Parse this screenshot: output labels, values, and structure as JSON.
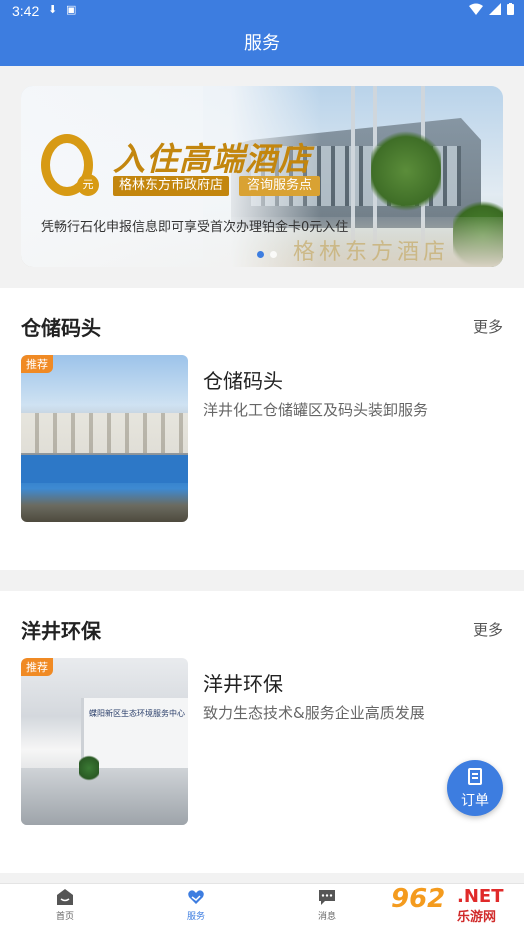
{
  "status_bar": {
    "time": "3:42"
  },
  "header": {
    "title": "服务"
  },
  "banner": {
    "headline": "入住高端酒店",
    "zero_symbol": "0",
    "yuan_label": "元",
    "hotel_name": "格林东方市政府店",
    "consult_label": "咨询服务点",
    "caption": "凭畅行石化申报信息即可享受首次办理铂金卡0元入住",
    "sign_text": "格林东方酒店",
    "slide_count": 2,
    "active_slide": 1
  },
  "sections": [
    {
      "title": "仓储码头",
      "more_label": "更多",
      "item": {
        "badge": "推荐",
        "title": "仓储码头",
        "description": "洋井化工仓储罐区及码头装卸服务"
      }
    },
    {
      "title": "洋井环保",
      "more_label": "更多",
      "item": {
        "badge": "推荐",
        "title": "洋井环保",
        "description": "致力生态技术&服务企业高质发展",
        "wall_text": "蝶阳新区生态环境服务中心"
      }
    }
  ],
  "fab": {
    "label": "订单"
  },
  "tabbar": {
    "items": [
      {
        "label": "首页",
        "icon": "home-icon"
      },
      {
        "label": "服务",
        "icon": "heart-hand-icon"
      },
      {
        "label": "消息",
        "icon": "chat-icon"
      }
    ],
    "active_index": 1
  },
  "watermark": {
    "number": "962",
    "net": ".NET",
    "sub": "乐游网"
  },
  "colors": {
    "primary": "#3d7de0",
    "badge": "#f08a24",
    "gold": "#c3860e"
  }
}
